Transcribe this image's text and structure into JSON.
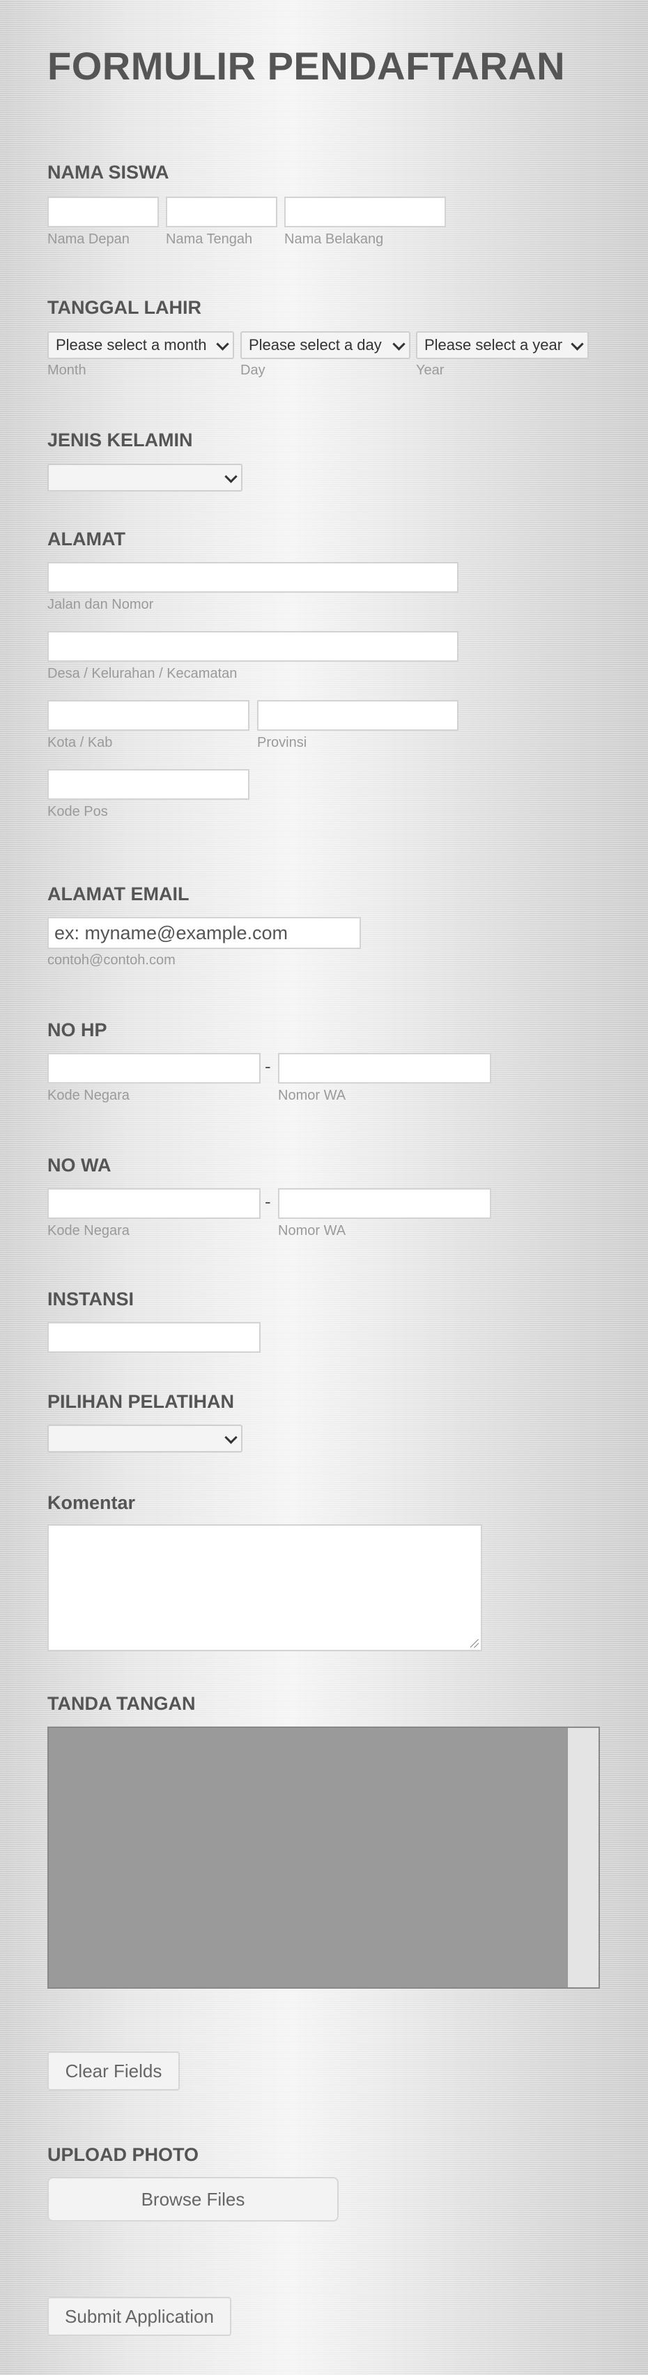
{
  "form": {
    "title": "FORMULIR PENDAFTARAN",
    "nama_siswa": {
      "label": "NAMA SISWA",
      "first_sub": "Nama Depan",
      "middle_sub": "Nama Tengah",
      "last_sub": "Nama Belakang"
    },
    "tanggal_lahir": {
      "label": "TANGGAL LAHIR",
      "month_value": "Please select a month",
      "day_value": "Please select a day",
      "year_value": "Please select a year",
      "month_sub": "Month",
      "day_sub": "Day",
      "year_sub": "Year"
    },
    "jenis_kelamin": {
      "label": "JENIS KELAMIN",
      "value": ""
    },
    "alamat": {
      "label": "ALAMAT",
      "street_sub": "Jalan dan Nomor",
      "area_sub": "Desa / Kelurahan / Kecamatan",
      "city_sub": "Kota / Kab",
      "province_sub": "Provinsi",
      "postal_sub": "Kode Pos"
    },
    "email": {
      "label": "ALAMAT EMAIL",
      "placeholder": "ex: myname@example.com",
      "sub": "contoh@contoh.com"
    },
    "no_hp": {
      "label": "NO HP",
      "separator": "-",
      "code_sub": "Kode Negara",
      "number_sub": "Nomor WA"
    },
    "no_wa": {
      "label": "NO WA",
      "separator": "-",
      "code_sub": "Kode Negara",
      "number_sub": "Nomor WA"
    },
    "instansi": {
      "label": "INSTANSI"
    },
    "pilihan_pelatihan": {
      "label": "PILIHAN PELATIHAN",
      "value": ""
    },
    "komentar": {
      "label": "Komentar"
    },
    "tanda_tangan": {
      "label": "TANDA TANGAN",
      "clear_label": "Clear Fields"
    },
    "upload": {
      "label": "UPLOAD PHOTO",
      "browse_label": "Browse Files"
    },
    "submit_label": "Submit Application"
  }
}
